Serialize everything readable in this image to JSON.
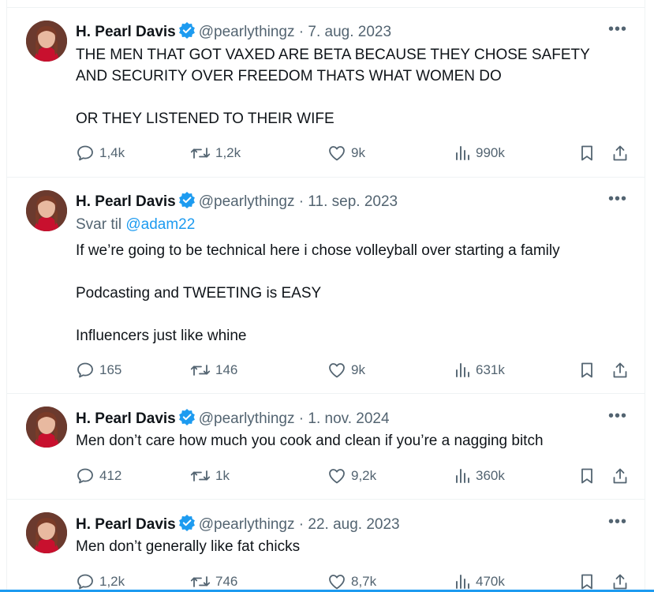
{
  "tweets": [
    {
      "name": "H. Pearl Davis",
      "handle_date": "@pearlythingz · 7. aug. 2023",
      "reply_prefix": "",
      "reply_to": "",
      "lines": [
        "THE MEN THAT GOT VAXED ARE BETA BECAUSE THEY CHOSE SAFETY AND SECURITY OVER FREEDOM THATS WHAT WOMEN DO",
        "OR THEY LISTENED TO THEIR WIFE"
      ],
      "replies": "1,4k",
      "retweets": "1,2k",
      "likes": "9k",
      "views": "990k"
    },
    {
      "name": "H. Pearl Davis",
      "handle_date": "@pearlythingz · 11. sep. 2023",
      "reply_prefix": "Svar til ",
      "reply_to": "@adam22",
      "lines": [
        "If we’re going to be technical here i chose volleyball over starting a family",
        "Podcasting and TWEETING is EASY",
        "Influencers just like whine"
      ],
      "replies": "165",
      "retweets": "146",
      "likes": "9k",
      "views": "631k"
    },
    {
      "name": "H. Pearl Davis",
      "handle_date": "@pearlythingz · 1. nov. 2024",
      "reply_prefix": "",
      "reply_to": "",
      "lines": [
        "Men don’t care how much you cook and clean if you’re a nagging bitch"
      ],
      "replies": "412",
      "retweets": "1k",
      "likes": "9,2k",
      "views": "360k"
    },
    {
      "name": "H. Pearl Davis",
      "handle_date": "@pearlythingz · 22. aug. 2023",
      "reply_prefix": "",
      "reply_to": "",
      "lines": [
        "Men don’t generally like fat chicks"
      ],
      "replies": "1,2k",
      "retweets": "746",
      "likes": "8,7k",
      "views": "470k"
    }
  ],
  "icons": {
    "verified": "verified-badge-icon",
    "more": "more-options-icon",
    "reply": "reply-icon",
    "retweet": "retweet-icon",
    "like": "heart-icon",
    "views": "views-icon",
    "bookmark": "bookmark-icon",
    "share": "share-icon"
  },
  "colors": {
    "accent": "#1d9bf0",
    "text": "#0f1419",
    "secondary": "#536471",
    "border": "#eff3f4"
  }
}
